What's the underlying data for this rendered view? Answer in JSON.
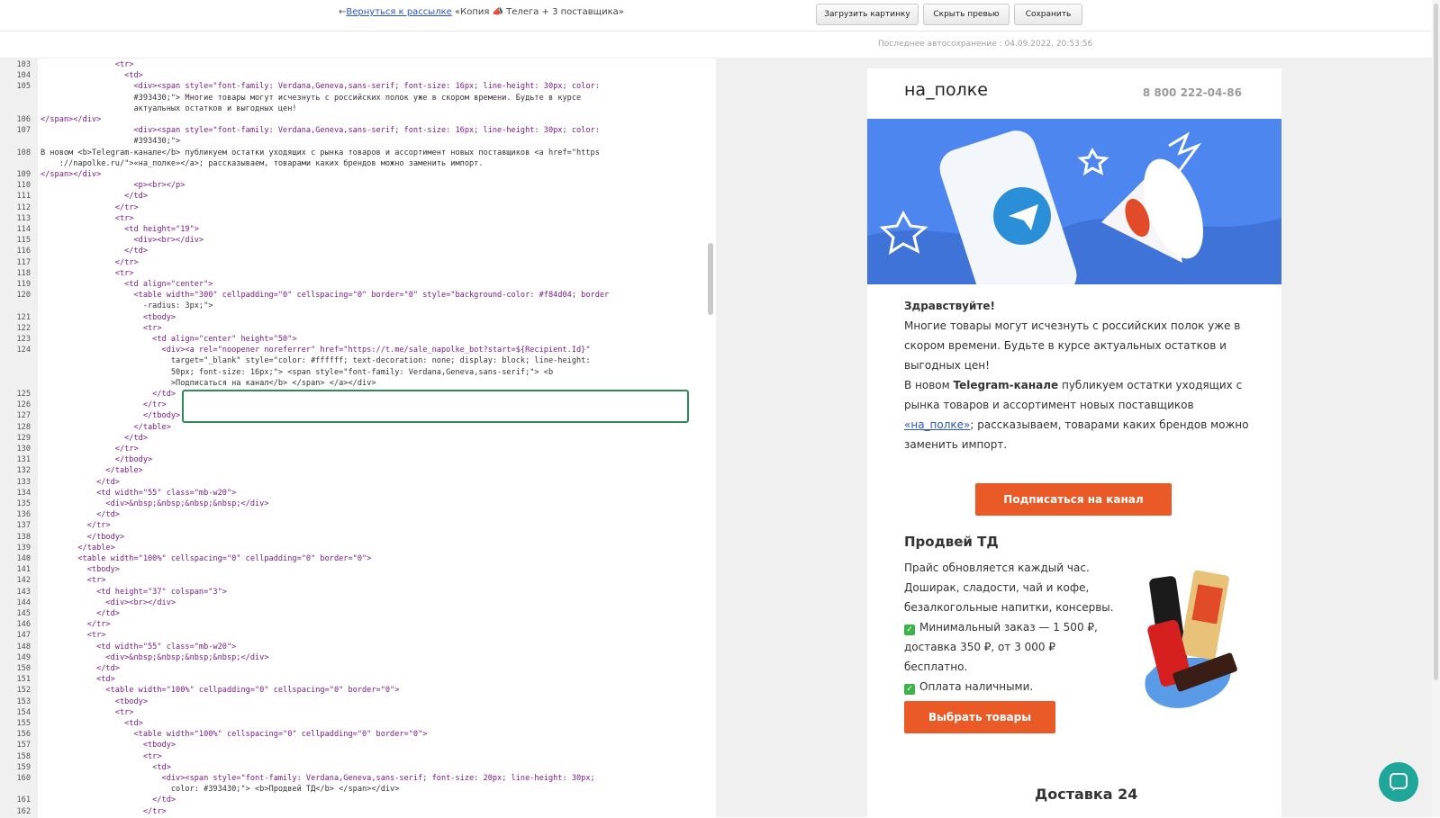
{
  "toolbar": {
    "back_link": "Вернуться к рассылке",
    "campaign_title": "«Копия 📣 Телега + 3 поставщика»",
    "upload_image": "Загрузить картинку",
    "hide_preview": "Скрыть превью",
    "save": "Сохранить"
  },
  "autosave": "Последнее автосохранение : 04.09.2022, 20:53:56",
  "editor": {
    "lines": [
      {
        "n": "103",
        "t": "                <tr>"
      },
      {
        "n": "104",
        "t": "                  <td>"
      },
      {
        "n": "105",
        "t": "                    <div><span style=\"font-family: Verdana,Geneva,sans-serif; font-size: 16px; line-height: 30px; color:"
      },
      {
        "n": "",
        "t": "                    #393430;\"> Многие товары могут исчезнуть с российских полок уже в скором времени. Будьте в курсе"
      },
      {
        "n": "",
        "t": "                    актуальных остатков и выгодных цен!"
      },
      {
        "n": "106",
        "t": "</span></div>"
      },
      {
        "n": "107",
        "t": "                    <div><span style=\"font-family: Verdana,Geneva,sans-serif; font-size: 16px; line-height: 30px; color:"
      },
      {
        "n": "",
        "t": "                    #393430;\">"
      },
      {
        "n": "108",
        "t": "В новом <b>Telegram-канале</b> публикуем остатки уходящих с рынка товаров и ассортимент новых поставщиков <a href=\"https"
      },
      {
        "n": "",
        "t": "    ://napolke.ru/\">«на_полке»</a>; рассказываем, товарами каких брендов можно заменить импорт."
      },
      {
        "n": "109",
        "t": "</span></div>"
      },
      {
        "n": "110",
        "t": "                    <p><br></p>"
      },
      {
        "n": "111",
        "t": "                  </td>"
      },
      {
        "n": "112",
        "t": "                </tr>"
      },
      {
        "n": "113",
        "t": "                <tr>"
      },
      {
        "n": "114",
        "t": "                  <td height=\"19\">"
      },
      {
        "n": "115",
        "t": "                    <div><br></div>"
      },
      {
        "n": "116",
        "t": "                  </td>"
      },
      {
        "n": "117",
        "t": "                </tr>"
      },
      {
        "n": "118",
        "t": "                <tr>"
      },
      {
        "n": "119",
        "t": "                  <td align=\"center\">"
      },
      {
        "n": "120",
        "t": "                    <table width=\"300\" cellpadding=\"0\" cellspacing=\"0\" border=\"0\" style=\"background-color: #f84d04; border"
      },
      {
        "n": "",
        "t": "                      -radius: 3px;\">"
      },
      {
        "n": "121",
        "t": "                      <tbody>"
      },
      {
        "n": "122",
        "t": "                      <tr>"
      },
      {
        "n": "123",
        "t": "                        <td align=\"center\" height=\"50\">"
      },
      {
        "n": "124",
        "t": "                          <div><a rel=\"noopener noreferrer\" href=\"https://t.me/sale_napolke_bot?start=${Recipient.Id}\""
      },
      {
        "n": "",
        "t": "                            target=\"_blank\" style=\"color: #ffffff; text-decoration: none; display: block; line-height:"
      },
      {
        "n": "",
        "t": "                            50px; font-size: 16px;\"> <span style=\"font-family: Verdana,Geneva,sans-serif;\"> <b"
      },
      {
        "n": "",
        "t": "                            >Подписаться на канал</b> </span> </a></div>"
      },
      {
        "n": "125",
        "t": "                        </td>"
      },
      {
        "n": "126",
        "t": "                      </tr>"
      },
      {
        "n": "127",
        "t": "                      </tbody>"
      },
      {
        "n": "128",
        "t": "                    </table>"
      },
      {
        "n": "129",
        "t": "                  </td>"
      },
      {
        "n": "130",
        "t": "                </tr>"
      },
      {
        "n": "131",
        "t": "                </tbody>"
      },
      {
        "n": "132",
        "t": "              </table>"
      },
      {
        "n": "133",
        "t": "            </td>"
      },
      {
        "n": "134",
        "t": "            <td width=\"55\" class=\"mb-w20\">"
      },
      {
        "n": "135",
        "t": "              <div>&nbsp;&nbsp;&nbsp;&nbsp;</div>"
      },
      {
        "n": "136",
        "t": "            </td>"
      },
      {
        "n": "137",
        "t": "          </tr>"
      },
      {
        "n": "138",
        "t": "          </tbody>"
      },
      {
        "n": "139",
        "t": "        </table>"
      },
      {
        "n": "140",
        "t": "        <table width=\"100%\" cellspacing=\"0\" cellpadding=\"0\" border=\"0\">"
      },
      {
        "n": "141",
        "t": "          <tbody>"
      },
      {
        "n": "142",
        "t": "          <tr>"
      },
      {
        "n": "143",
        "t": "            <td height=\"37\" colspan=\"3\">"
      },
      {
        "n": "144",
        "t": "              <div><br></div>"
      },
      {
        "n": "145",
        "t": "            </td>"
      },
      {
        "n": "146",
        "t": "          </tr>"
      },
      {
        "n": "147",
        "t": "          <tr>"
      },
      {
        "n": "148",
        "t": "            <td width=\"55\" class=\"mb-w20\">"
      },
      {
        "n": "149",
        "t": "              <div>&nbsp;&nbsp;&nbsp;&nbsp;</div>"
      },
      {
        "n": "150",
        "t": "            </td>"
      },
      {
        "n": "151",
        "t": "            <td>"
      },
      {
        "n": "152",
        "t": "              <table width=\"100%\" cellpadding=\"0\" cellspacing=\"0\" border=\"0\">"
      },
      {
        "n": "153",
        "t": "                <tbody>"
      },
      {
        "n": "154",
        "t": "                <tr>"
      },
      {
        "n": "155",
        "t": "                  <td>"
      },
      {
        "n": "156",
        "t": "                    <table width=\"100%\" cellspacing=\"0\" cellpadding=\"0\" border=\"0\">"
      },
      {
        "n": "157",
        "t": "                      <tbody>"
      },
      {
        "n": "158",
        "t": "                      <tr>"
      },
      {
        "n": "159",
        "t": "                        <td>"
      },
      {
        "n": "160",
        "t": "                          <div><span style=\"font-family: Verdana,Geneva,sans-serif; font-size: 20px; line-height: 30px;"
      },
      {
        "n": "",
        "t": "                            color: #393430;\"> <b>Продвей ТД</b> </span></div>"
      },
      {
        "n": "161",
        "t": "                        </td>"
      },
      {
        "n": "162",
        "t": "                      </tr>"
      }
    ]
  },
  "preview": {
    "logo": "на_полке",
    "phone": "8 800 222-04-86",
    "greeting": "Здравствуйте!",
    "p1": [
      "Многие товары могут исчезнуть с российских полок уже в",
      "скором времени. Будьте в курсе актуальных остатков и",
      "выгодных цен!"
    ],
    "p2_a": "В новом ",
    "p2_b": "Telegram-канале",
    "p2_c": " публикуем остатки уходящих с",
    "p2_line2": "рынка товаров и ассортимент новых поставщиков",
    "p2_link": "«на_полке»",
    "p2_line3": "; рассказываем, товарами каких брендов можно",
    "p2_line4": "заменить импорт.",
    "subscribe_btn": "Подписаться на канал",
    "section_title": "Продвей ТД",
    "s_lines": [
      "Прайс обновляется каждый час.",
      "Доширак, сладости, чай и кофе,",
      "безалкогольные напитки, консервы."
    ],
    "bullet1": "Минимальный заказ — 1 500 ₽,",
    "bullet1_l2": "доставка 350 ₽, от 3 000 ₽",
    "bullet1_l3": "бесплатно.",
    "bullet2": "Оплата наличными.",
    "choose_btn": "Выбрать товары",
    "next_section": "Доставка 24"
  },
  "colors": {
    "accent": "#ea5a26",
    "hero": "#4e86ef",
    "highlight": "#2e8b57"
  }
}
